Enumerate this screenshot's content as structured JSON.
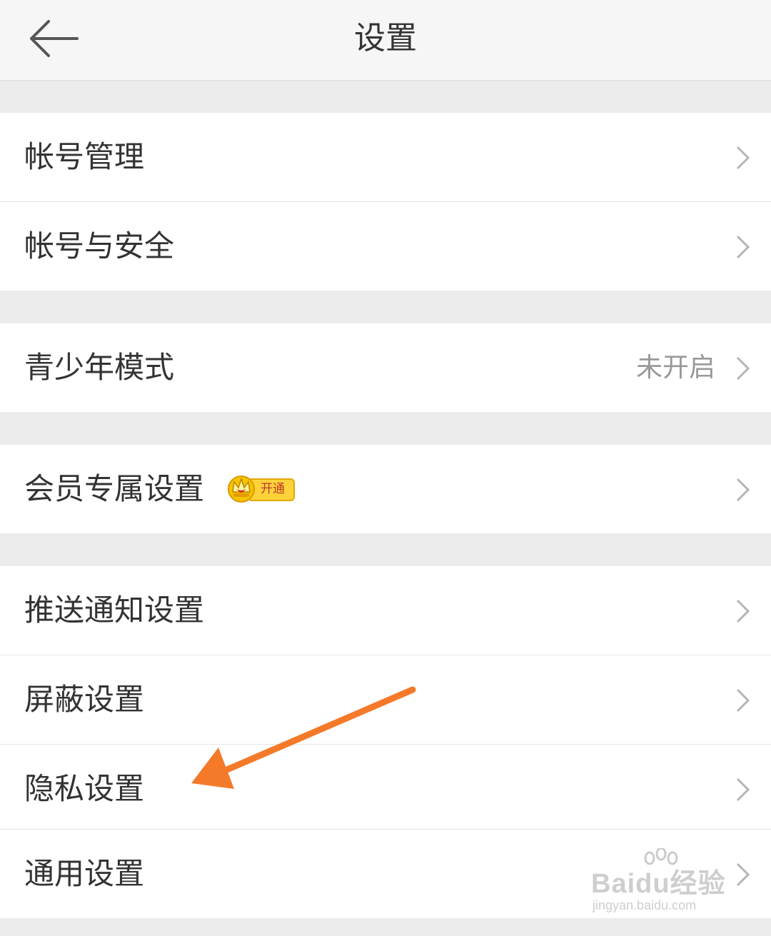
{
  "header": {
    "title": "设置",
    "back_icon": "arrow-left-icon"
  },
  "items": [
    {
      "label": "帐号管理"
    },
    {
      "label": "帐号与安全"
    },
    {
      "label": "青少年模式",
      "value": "未开启"
    },
    {
      "label": "会员专属设置",
      "badge": "开通",
      "badge_icon": "crown-icon"
    },
    {
      "label": "推送通知设置"
    },
    {
      "label": "屏蔽设置"
    },
    {
      "label": "隐私设置"
    },
    {
      "label": "通用设置"
    }
  ],
  "annotation": {
    "color": "#f47a2a"
  },
  "watermark": {
    "logo": "Baidu经验",
    "url": "jingyan.baidu.com"
  },
  "colors": {
    "background": "#ececec",
    "row": "#ffffff",
    "text": "#333333",
    "value": "#999999",
    "chevron": "#b5b5b5"
  }
}
